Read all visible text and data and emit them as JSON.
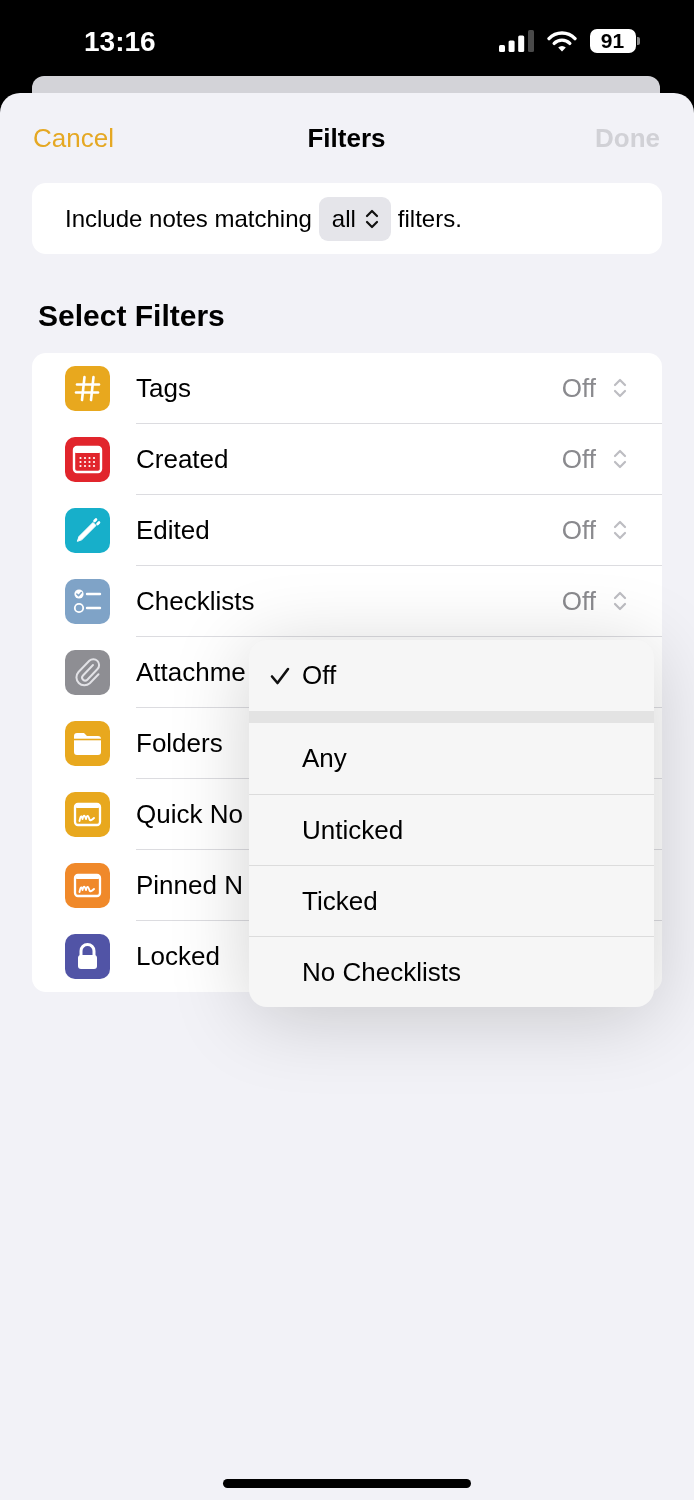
{
  "status_bar": {
    "time": "13:16",
    "battery": "91"
  },
  "nav": {
    "cancel": "Cancel",
    "title": "Filters",
    "done": {
      "label": "Done",
      "disabled": true
    }
  },
  "match": {
    "prefix": "Include notes matching",
    "value": "all",
    "suffix": "filters."
  },
  "section_title": "Select Filters",
  "filters": [
    {
      "label": "Tags",
      "color": "#e8a81e",
      "value": "Off"
    },
    {
      "label": "Created",
      "color": "#e1252c",
      "value": "Off"
    },
    {
      "label": "Edited",
      "color": "#17afca",
      "value": "Off"
    },
    {
      "label": "Checklists",
      "color": "#7fa3c7",
      "value": "Off"
    },
    {
      "label": "Attachme",
      "color": "#8e8e93"
    },
    {
      "label": "Folders",
      "color": "#e8a81e"
    },
    {
      "label": "Quick No",
      "color": "#e8a81e"
    },
    {
      "label": "Pinned N",
      "color": "#f0892a"
    },
    {
      "label": "Locked",
      "color": "#5154a6"
    }
  ],
  "menu": {
    "groups": [
      {
        "items": [
          {
            "label": "Off",
            "selected": true
          }
        ]
      },
      {
        "items": [
          {
            "label": "Any",
            "selected": false
          },
          {
            "label": "Unticked",
            "selected": false
          },
          {
            "label": "Ticked",
            "selected": false
          },
          {
            "label": "No Checklists",
            "selected": false
          }
        ]
      }
    ]
  }
}
